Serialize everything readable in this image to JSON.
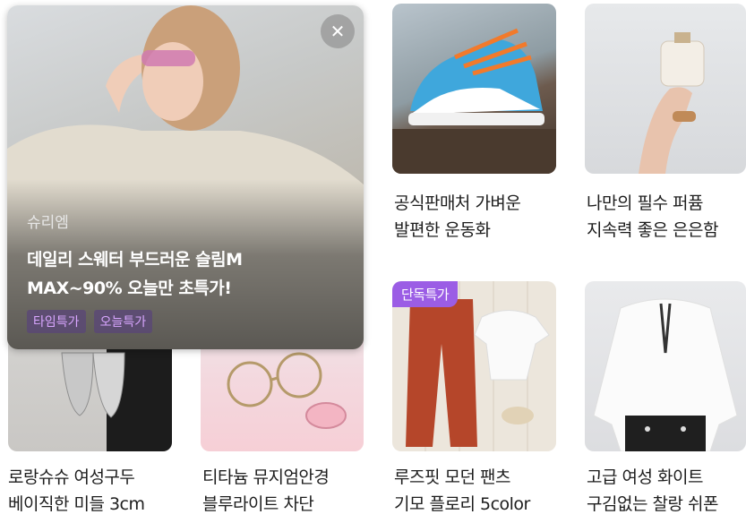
{
  "products": [
    {
      "title_line1": "공식판매처 가벼운",
      "title_line2": "발편한 운동화",
      "image": "sneaker-photo"
    },
    {
      "title_line1": "나만의 필수 퍼퓸",
      "title_line2": "지속력 좋은 은은함",
      "image": "perfume-photo"
    },
    {
      "title_line1": "로랑슈슈 여성구두",
      "title_line2": "베이직한 미들 3cm",
      "image": "silver-shoes-photo"
    },
    {
      "title_line1": "티타늄 뮤지엄안경",
      "title_line2": "블루라이트 차단",
      "image": "glasses-photo"
    },
    {
      "title_line1": "루즈핏 모던 팬츠",
      "title_line2": "기모 플로리 5color",
      "image": "pants-photo",
      "badge": "단독특가"
    },
    {
      "title_line1": "고급 여성 화이트",
      "title_line2": "구김없는 찰랑 쉬폰",
      "image": "blouse-photo"
    }
  ],
  "overlay_ad": {
    "brand": "슈리엠",
    "headline_line1": "데일리 스웨터 부드러운 슬림M",
    "headline_line2": "MAX~90% 오늘만 초특가!",
    "tags": [
      "타임특가",
      "오늘특가"
    ],
    "close_icon": "close-icon"
  },
  "colors": {
    "badge_bg": "#9b5de5",
    "tag_text": "#d9a6ff"
  }
}
